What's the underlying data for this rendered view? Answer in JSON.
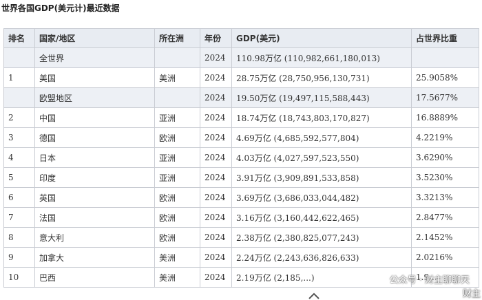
{
  "title": "世界各国GDP(美元计)最近数据",
  "table": {
    "headers": [
      "排名",
      "国家/地区",
      "所在洲",
      "年份",
      "GDP(美元)",
      "占世界比重"
    ],
    "rows": [
      {
        "rank": "",
        "country": "全世界",
        "continent": "",
        "year": "2024",
        "gdp": "110.98万亿 (110,982,661,180,013)",
        "share": "",
        "highlight": true
      },
      {
        "rank": "1",
        "country": "美国",
        "continent": "美洲",
        "year": "2024",
        "gdp": "28.75万亿 (28,750,956,130,731)",
        "share": "25.9058%",
        "highlight": false
      },
      {
        "rank": "",
        "country": "欧盟地区",
        "continent": "",
        "year": "2024",
        "gdp": "19.50万亿 (19,497,115,588,443)",
        "share": "17.5677%",
        "highlight": true
      },
      {
        "rank": "2",
        "country": "中国",
        "continent": "亚洲",
        "year": "2024",
        "gdp": "18.74万亿 (18,743,803,170,827)",
        "share": "16.8889%",
        "highlight": false
      },
      {
        "rank": "3",
        "country": "德国",
        "continent": "欧洲",
        "year": "2024",
        "gdp": "4.69万亿 (4,685,592,577,804)",
        "share": "4.2219%",
        "highlight": false
      },
      {
        "rank": "4",
        "country": "日本",
        "continent": "亚洲",
        "year": "2024",
        "gdp": "4.03万亿 (4,027,597,523,550)",
        "share": "3.6290%",
        "highlight": false
      },
      {
        "rank": "5",
        "country": "印度",
        "continent": "亚洲",
        "year": "2024",
        "gdp": "3.91万亿 (3,909,891,533,858)",
        "share": "3.5230%",
        "highlight": false
      },
      {
        "rank": "6",
        "country": "英国",
        "continent": "欧洲",
        "year": "2024",
        "gdp": "3.69万亿 (3,686,033,044,482)",
        "share": "3.3213%",
        "highlight": false
      },
      {
        "rank": "7",
        "country": "法国",
        "continent": "欧洲",
        "year": "2024",
        "gdp": "3.16万亿 (3,160,442,622,465)",
        "share": "2.8477%",
        "highlight": false
      },
      {
        "rank": "8",
        "country": "意大利",
        "continent": "欧洲",
        "year": "2024",
        "gdp": "2.38万亿 (2,380,825,077,243)",
        "share": "2.1452%",
        "highlight": false
      },
      {
        "rank": "9",
        "country": "加拿大",
        "continent": "美洲",
        "year": "2024",
        "gdp": "2.24万亿 (2,243,636,826,633)",
        "share": "2.0216%",
        "highlight": false
      },
      {
        "rank": "10",
        "country": "巴西",
        "continent": "美洲",
        "year": "2024",
        "gdp": "2.19万亿 (2,185,...)",
        "share": "1.9...",
        "highlight": false
      }
    ]
  },
  "watermark": {
    "text": "公众号 · 财主聊聊天",
    "text2": "财主",
    "icon": "wechat-icon"
  }
}
